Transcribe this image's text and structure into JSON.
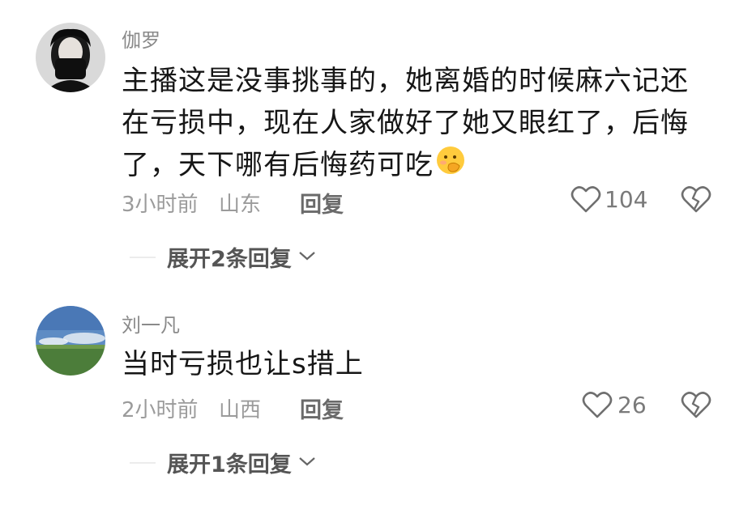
{
  "comments": [
    {
      "username": "伽罗",
      "text_lines": [
        "主播这是没事挑事的，她离婚的时候麻六记还",
        "在亏损中，现在人家做好了她又眼红了，后悔",
        "了，天下哪有后悔药可吃"
      ],
      "emoji_icon": "face-with-hand-over-mouth-emoji",
      "time": "3小时前",
      "location": "山东",
      "reply_label": "回复",
      "likes": "104",
      "expand_label": "展开2条回复"
    },
    {
      "username": "刘一凡",
      "text": "当时亏损也让s措上",
      "time": "2小时前",
      "location": "山西",
      "reply_label": "回复",
      "likes": "26",
      "expand_label": "展开1条回复"
    }
  ],
  "icons": {
    "like": "heart-outline-icon",
    "dislike": "broken-heart-icon",
    "expand": "chevron-down-icon"
  },
  "colors": {
    "text": "#161616",
    "secondary": "#9b9b9b",
    "avatar2_sky": "#5e8cc4",
    "avatar2_grass": "#4c7d3a"
  }
}
